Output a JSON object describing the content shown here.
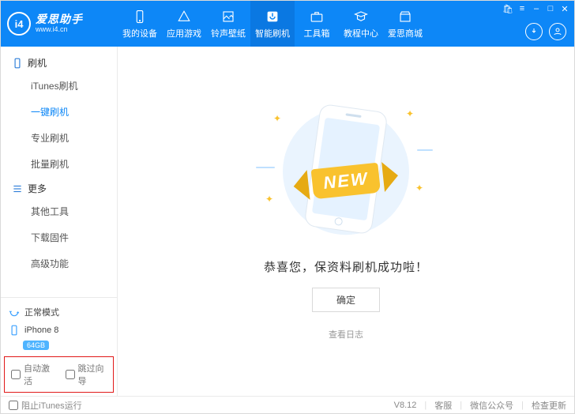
{
  "brand": {
    "name": "i4",
    "title_cn": "爱思助手",
    "title_en": "www.i4.cn"
  },
  "titlebar": {
    "cart": "🛍",
    "menu": "≡",
    "min": "–",
    "max": "□",
    "close": "✕"
  },
  "nav": [
    {
      "key": "device",
      "label": "我的设备"
    },
    {
      "key": "apps",
      "label": "应用游戏"
    },
    {
      "key": "ring",
      "label": "铃声壁纸"
    },
    {
      "key": "flash",
      "label": "智能刷机",
      "active": true
    },
    {
      "key": "toolbox",
      "label": "工具箱"
    },
    {
      "key": "tutorial",
      "label": "教程中心"
    },
    {
      "key": "mall",
      "label": "爱思商城"
    }
  ],
  "sidebar": {
    "group_flash": "刷机",
    "items_flash": [
      {
        "label": "iTunes刷机"
      },
      {
        "label": "一键刷机",
        "active": true
      },
      {
        "label": "专业刷机"
      },
      {
        "label": "批量刷机"
      }
    ],
    "group_more": "更多",
    "items_more": [
      {
        "label": "其他工具"
      },
      {
        "label": "下载固件"
      },
      {
        "label": "高级功能"
      }
    ],
    "mode": "正常模式",
    "device": "iPhone 8",
    "storage": "64GB",
    "auto_activate": "自动激活",
    "skip_guide": "跳过向导"
  },
  "main": {
    "ribbon": "NEW",
    "success": "恭喜您，保资料刷机成功啦！",
    "ok": "确定",
    "view_log": "查看日志"
  },
  "status": {
    "block_itunes": "阻止iTunes运行",
    "version": "V8.12",
    "support": "客服",
    "wechat": "微信公众号",
    "update": "检查更新"
  }
}
